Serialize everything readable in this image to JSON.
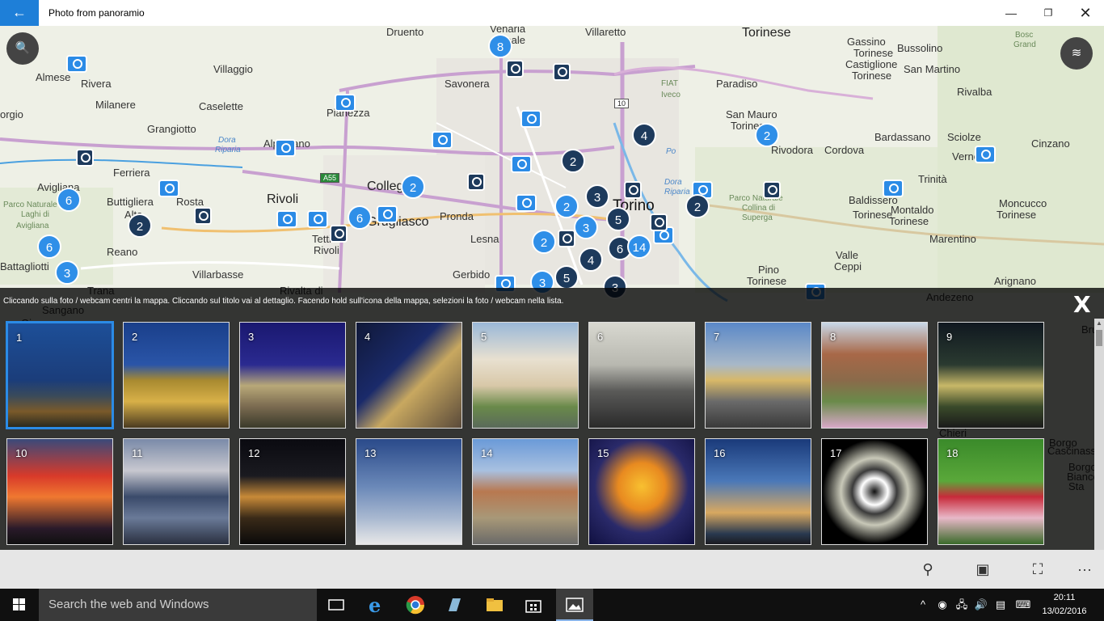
{
  "titlebar": {
    "title": "Photo from panoramio",
    "back_icon": "←",
    "minimize_icon": "—",
    "maximize_icon": "❐",
    "close_icon": "✕"
  },
  "map": {
    "labels": [
      {
        "text": "Druento",
        "cls": ""
      },
      {
        "text": "Venaria",
        "cls": ""
      },
      {
        "text": "Reale",
        "cls": ""
      },
      {
        "text": "Villaretto",
        "cls": ""
      },
      {
        "text": "Torinese",
        "cls": "big"
      },
      {
        "text": "Gassino",
        "cls": ""
      },
      {
        "text": "Torinese",
        "cls": ""
      },
      {
        "text": "Castiglione",
        "cls": ""
      },
      {
        "text": "Torinese",
        "cls": ""
      },
      {
        "text": "Bussolino",
        "cls": ""
      },
      {
        "text": "San Martino",
        "cls": ""
      },
      {
        "text": "Rivalba",
        "cls": ""
      },
      {
        "text": "Bosc",
        "cls": "park"
      },
      {
        "text": "Grand",
        "cls": "park"
      },
      {
        "text": "Almese",
        "cls": ""
      },
      {
        "text": "Rivera",
        "cls": ""
      },
      {
        "text": "Villaggio",
        "cls": ""
      },
      {
        "text": "Savonera",
        "cls": ""
      },
      {
        "text": "Paradiso",
        "cls": ""
      },
      {
        "text": "Milanere",
        "cls": ""
      },
      {
        "text": "Caselette",
        "cls": ""
      },
      {
        "text": "Pianezza",
        "cls": ""
      },
      {
        "text": "FIAT",
        "cls": "park"
      },
      {
        "text": "Iveco",
        "cls": "park"
      },
      {
        "text": "San Mauro",
        "cls": ""
      },
      {
        "text": "Torinese",
        "cls": ""
      },
      {
        "text": "Grangiotto",
        "cls": ""
      },
      {
        "text": "Dora",
        "cls": "river"
      },
      {
        "text": "Riparia",
        "cls": "river"
      },
      {
        "text": "Alpignano",
        "cls": ""
      },
      {
        "text": "Rivodora",
        "cls": ""
      },
      {
        "text": "Cordova",
        "cls": ""
      },
      {
        "text": "Bardassano",
        "cls": ""
      },
      {
        "text": "Sciolze",
        "cls": ""
      },
      {
        "text": "Cinzano",
        "cls": ""
      },
      {
        "text": "orgio",
        "cls": ""
      },
      {
        "text": "Ferriera",
        "cls": ""
      },
      {
        "text": "Vernone",
        "cls": ""
      },
      {
        "text": "Trinità",
        "cls": ""
      },
      {
        "text": "Avigliana",
        "cls": ""
      },
      {
        "text": "Buttigliera",
        "cls": ""
      },
      {
        "text": "Alta",
        "cls": ""
      },
      {
        "text": "Rosta",
        "cls": ""
      },
      {
        "text": "Rivoli",
        "cls": "big"
      },
      {
        "text": "Collegno",
        "cls": "big"
      },
      {
        "text": "Torino",
        "cls": "huge"
      },
      {
        "text": "Parco Naturale",
        "cls": "park"
      },
      {
        "text": "Collina di",
        "cls": "park"
      },
      {
        "text": "Superga",
        "cls": "park"
      },
      {
        "text": "Baldissero",
        "cls": ""
      },
      {
        "text": "Torinese",
        "cls": ""
      },
      {
        "text": "Montaldo",
        "cls": ""
      },
      {
        "text": "Torinese",
        "cls": ""
      },
      {
        "text": "Moncucco",
        "cls": ""
      },
      {
        "text": "Torinese",
        "cls": ""
      },
      {
        "text": "Parco Naturale",
        "cls": "park"
      },
      {
        "text": "Laghi di",
        "cls": "park"
      },
      {
        "text": "Avigliana",
        "cls": "park"
      },
      {
        "text": "Grugliasco",
        "cls": "big"
      },
      {
        "text": "Pronda",
        "cls": ""
      },
      {
        "text": "Tetti",
        "cls": ""
      },
      {
        "text": "Rivoli",
        "cls": ""
      },
      {
        "text": "Lesna",
        "cls": ""
      },
      {
        "text": "Marentino",
        "cls": ""
      },
      {
        "text": "Reano",
        "cls": ""
      },
      {
        "text": "Trana",
        "cls": ""
      },
      {
        "text": "Villarbasse",
        "cls": ""
      },
      {
        "text": "Gerbido",
        "cls": ""
      },
      {
        "text": "Pino",
        "cls": ""
      },
      {
        "text": "Torinese",
        "cls": ""
      },
      {
        "text": "Valle",
        "cls": ""
      },
      {
        "text": "Ceppi",
        "cls": ""
      },
      {
        "text": "Arignano",
        "cls": ""
      },
      {
        "text": "Battagliotti",
        "cls": ""
      },
      {
        "text": "Rivalta di",
        "cls": ""
      },
      {
        "text": "Andezeno",
        "cls": ""
      },
      {
        "text": "Po",
        "cls": "river"
      },
      {
        "text": "Dora",
        "cls": "river"
      },
      {
        "text": "Riparia",
        "cls": "river"
      },
      {
        "text": "Sangano",
        "cls": ""
      },
      {
        "text": "Giaveno",
        "cls": ""
      },
      {
        "text": "Bru",
        "cls": ""
      },
      {
        "text": "Chieri",
        "cls": ""
      },
      {
        "text": "Borgo",
        "cls": ""
      },
      {
        "text": "Cascinassa",
        "cls": ""
      },
      {
        "text": "Borgo",
        "cls": ""
      },
      {
        "text": "Bianco",
        "cls": ""
      },
      {
        "text": "Sta",
        "cls": ""
      }
    ],
    "road_shields": [
      "10",
      "A55"
    ],
    "clusters": [
      {
        "n": "8",
        "t": "light"
      },
      {
        "n": "4",
        "t": "dark"
      },
      {
        "n": "2",
        "t": "dark"
      },
      {
        "n": "2",
        "t": "light"
      },
      {
        "n": "2",
        "t": "light"
      },
      {
        "n": "6",
        "t": "light"
      },
      {
        "n": "2",
        "t": "dark"
      },
      {
        "n": "3",
        "t": "dark"
      },
      {
        "n": "2",
        "t": "light"
      },
      {
        "n": "6",
        "t": "light"
      },
      {
        "n": "3",
        "t": "light"
      },
      {
        "n": "5",
        "t": "dark"
      },
      {
        "n": "2",
        "t": "dark"
      },
      {
        "n": "2",
        "t": "light"
      },
      {
        "n": "6",
        "t": "light"
      },
      {
        "n": "6",
        "t": "dark"
      },
      {
        "n": "14",
        "t": "light"
      },
      {
        "n": "4",
        "t": "dark"
      },
      {
        "n": "3",
        "t": "light"
      },
      {
        "n": "3",
        "t": "light"
      },
      {
        "n": "5",
        "t": "dark"
      },
      {
        "n": "3",
        "t": "dark"
      }
    ],
    "camera_icon": "camera-icon",
    "webcam_icon": "webcam-icon",
    "search_button_icon": "🔍",
    "layers_button_icon": "≋"
  },
  "overlay": {
    "instruction": "Cliccando sulla foto / webcam centri la mappa. Cliccando sul titolo vai al dettaglio. Facendo hold sull'icona della mappa, selezioni la foto / webcam nella lista.",
    "close_label": "X",
    "thumbnails": [
      {
        "num": "1",
        "bg": "linear-gradient(#1d4f98 0%, #1b3d7a 55%, #3a4a5a 70%, #7a5a2a 85%, #2a2a20 100%)"
      },
      {
        "num": "2",
        "bg": "linear-gradient(#1a3f8a 0%, #2a55a8 40%, #a88a30 55%, #d8b048 75%, #4a3a20 100%)"
      },
      {
        "num": "3",
        "bg": "linear-gradient(#1a1870 0%, #2a2a90 40%, #b8a878 60%, #7a6a50 80%, #3a3a2a 100%)"
      },
      {
        "num": "4",
        "bg": "linear-gradient(135deg, #101838 0%, #1a2a6a 40%, #c8a860 60%, #5a4a3a 100%)"
      },
      {
        "num": "5",
        "bg": "linear-gradient(#9ab8d8 0%, #e8e0d0 35%, #d8c8a8 60%, #6a8a4a 80%, #5a6a5a 100%)"
      },
      {
        "num": "6",
        "bg": "linear-gradient(#d8d8d0 0%, #b8b8b0 40%, #5a5a58 65%, #2a2a2a 100%)"
      },
      {
        "num": "7",
        "bg": "linear-gradient(#5a88c8 0%, #a8b8c8 40%, #d8b868 55%, #6a6a6a 75%, #3a3a3a 100%)"
      },
      {
        "num": "8",
        "bg": "linear-gradient(#c8d8e8 0%, #a86848 30%, #8a6a4a 55%, #6a8a4a 75%, #d8a8c8 100%)"
      },
      {
        "num": "9",
        "bg": "linear-gradient(#101820 0%, #2a3a30 40%, #c8b868 60%, #3a4a2a 80%, #1a1a1a 100%)"
      },
      {
        "num": "10",
        "bg": "linear-gradient(#3a4a7a 0%, #d83a2a 35%, #f07830 55%, #2a1a2a 85%, #101010 100%)"
      },
      {
        "num": "11",
        "bg": "linear-gradient(#7a8aa8 0%, #c8c8d0 30%, #3a4a6a 55%, #6a7a98 75%, #2a3040 100%)"
      },
      {
        "num": "12",
        "bg": "linear-gradient(#0a0a10 0%, #1a1a20 35%, #c88a38 55%, #3a2a18 75%, #0a0a0a 100%)"
      },
      {
        "num": "13",
        "bg": "linear-gradient(#2a4a8a 0%, #6a88b8 45%, #a8b8d0 75%, #e8e8e8 100%)"
      },
      {
        "num": "14",
        "bg": "linear-gradient(#6a9ad8 0%, #a8c0e0 30%, #b87850 50%, #a89878 75%, #6a6a68 100%)"
      },
      {
        "num": "15",
        "bg": "radial-gradient(circle at 50% 45%, #f8c030 0%, #e88a20 30%, #2a2a6a 60%, #101040 100%)"
      },
      {
        "num": "16",
        "bg": "linear-gradient(#1a3a7a 0%, #4a78b8 40%, #d8a860 70%, #2a3a50 90%, #1a1a20 100%)"
      },
      {
        "num": "17",
        "bg": "radial-gradient(circle at 50% 50%, #101010 0%, #ffffff 18%, #3a3a3a 30%, #c8c8b8 45%, #000000 70%)"
      },
      {
        "num": "18",
        "bg": "linear-gradient(#3a8a2a 0%, #5aa83a 40%, #c82a3a 55%, #e8b8c8 75%, #3a6a2a 100%)"
      }
    ]
  },
  "appbar": {
    "search_icon": "⚲",
    "gallery_icon": "▣",
    "person_icon": "⛶",
    "more_icon": "···"
  },
  "taskbar": {
    "search_placeholder": "Search the web and Windows",
    "time": "20:11",
    "date": "13/02/2016"
  }
}
